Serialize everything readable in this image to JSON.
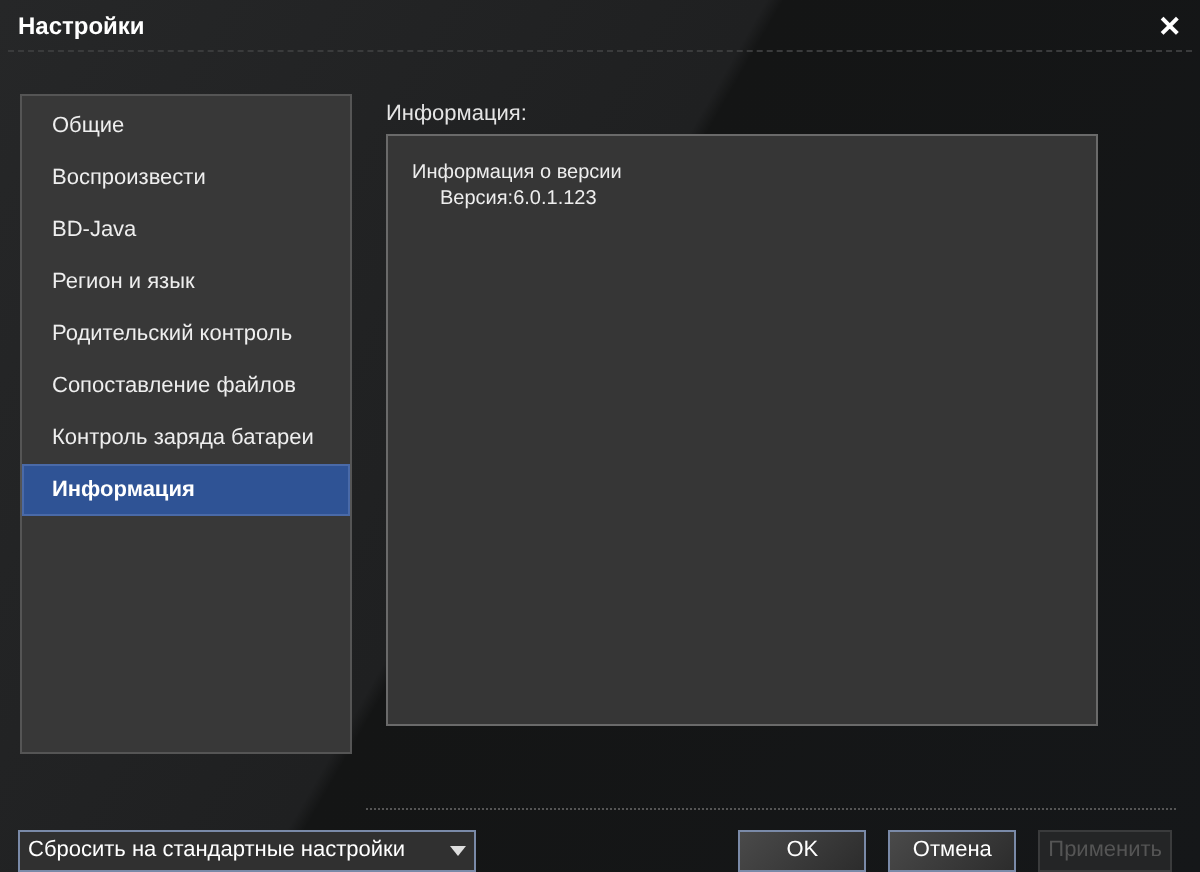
{
  "window": {
    "title": "Настройки",
    "close": "✕"
  },
  "sidebar": {
    "items": [
      {
        "label": "Общие",
        "selected": false
      },
      {
        "label": "Воспроизвести",
        "selected": false
      },
      {
        "label": "BD-Java",
        "selected": false
      },
      {
        "label": "Регион и язык",
        "selected": false
      },
      {
        "label": "Родительский контроль",
        "selected": false
      },
      {
        "label": "Сопоставление файлов",
        "selected": false
      },
      {
        "label": "Контроль заряда батареи",
        "selected": false
      },
      {
        "label": "Информация",
        "selected": true
      }
    ]
  },
  "content": {
    "heading": "Информация:",
    "lines": [
      "Информация о версии",
      "Версия:6.0.1.123"
    ]
  },
  "footer": {
    "reset_dropdown": "Сбросить на стандартные настройки",
    "buttons": [
      {
        "label": "OK",
        "disabled": false
      },
      {
        "label": "Отмена",
        "disabled": false
      },
      {
        "label": "Применить",
        "disabled": true
      }
    ]
  }
}
